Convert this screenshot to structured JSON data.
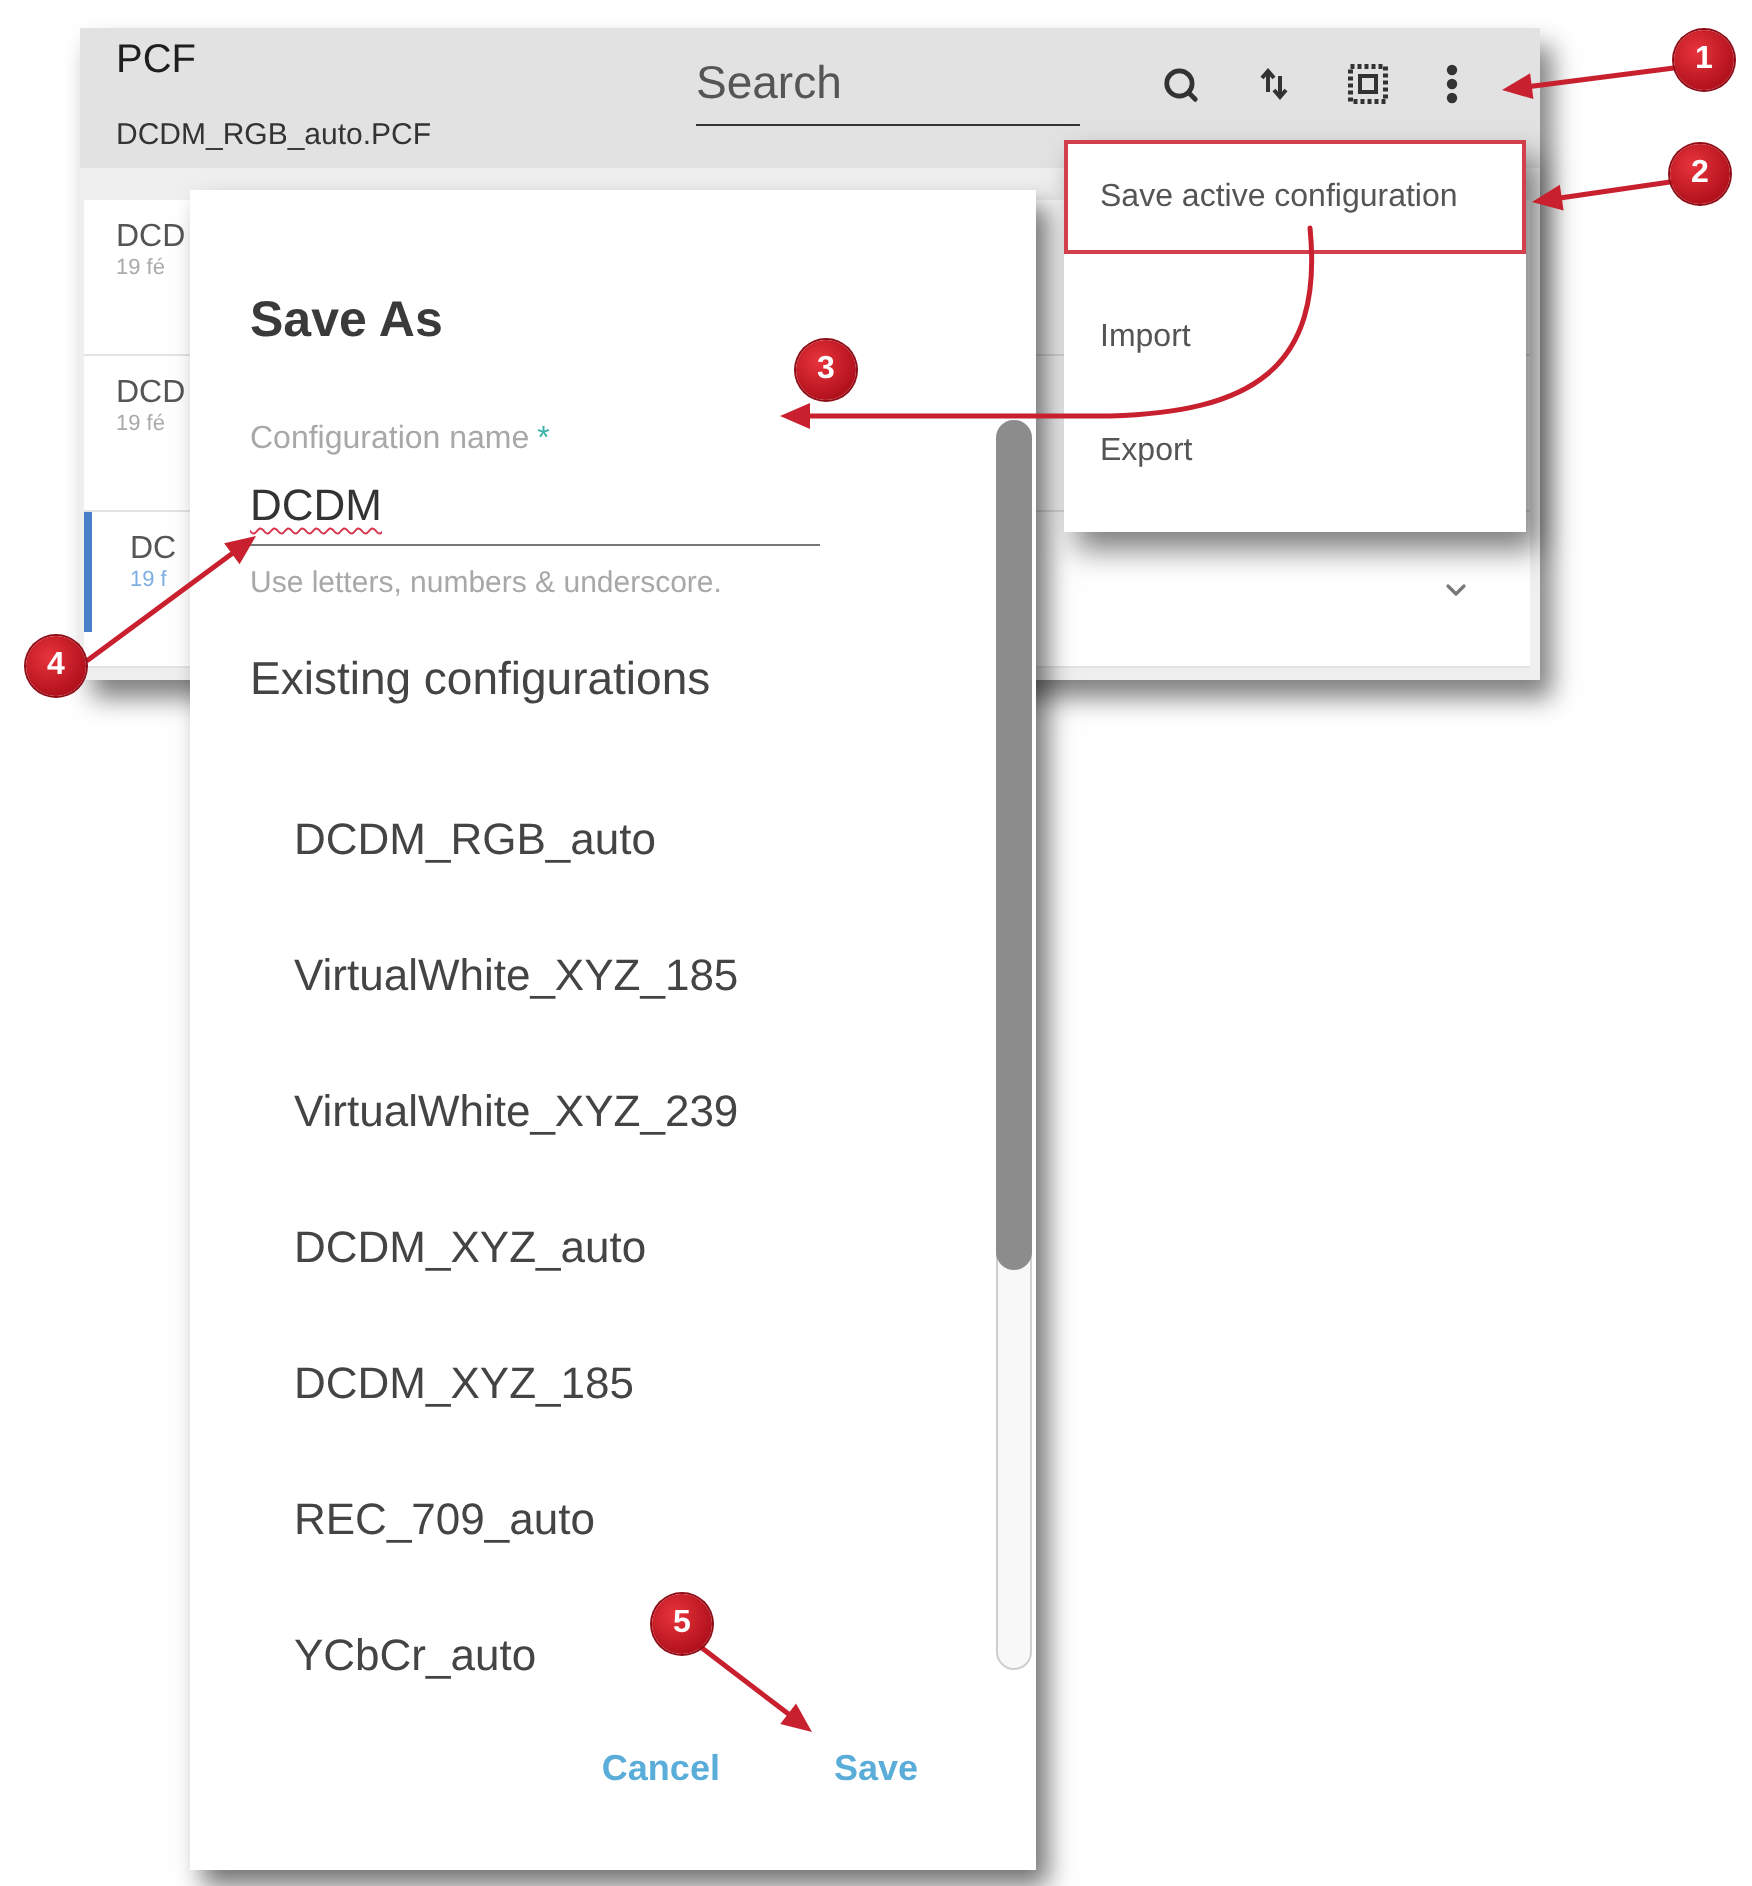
{
  "app": {
    "title": "PCF",
    "subtitle": "DCDM_RGB_auto.PCF",
    "search": {
      "placeholder": "Search"
    },
    "list": [
      {
        "name": "DCD",
        "date": "19 fé",
        "selected": false,
        "chevron": false
      },
      {
        "name": "DCD",
        "date": "19 fé",
        "selected": false,
        "chevron": false
      },
      {
        "name": "DC",
        "date": "19 f",
        "selected": true,
        "chevron": true
      }
    ]
  },
  "menu": {
    "items": [
      {
        "label": "Save active configuration",
        "highlighted": true
      },
      {
        "label": "Import",
        "highlighted": false
      },
      {
        "label": "Export",
        "highlighted": false
      }
    ]
  },
  "dialog": {
    "title": "Save As",
    "field": {
      "label": "Configuration name",
      "required_mark": "*",
      "value": "DCDM",
      "misspelled": true,
      "helper": "Use letters, numbers & underscore."
    },
    "section_title": "Existing configurations",
    "configurations": [
      "DCDM_RGB_auto",
      "VirtualWhite_XYZ_185",
      "VirtualWhite_XYZ_239",
      "DCDM_XYZ_auto",
      "DCDM_XYZ_185",
      "REC_709_auto",
      "YCbCr_auto"
    ],
    "buttons": [
      "Cancel",
      "Save"
    ]
  },
  "callouts": [
    "1",
    "2",
    "3",
    "4",
    "5"
  ]
}
